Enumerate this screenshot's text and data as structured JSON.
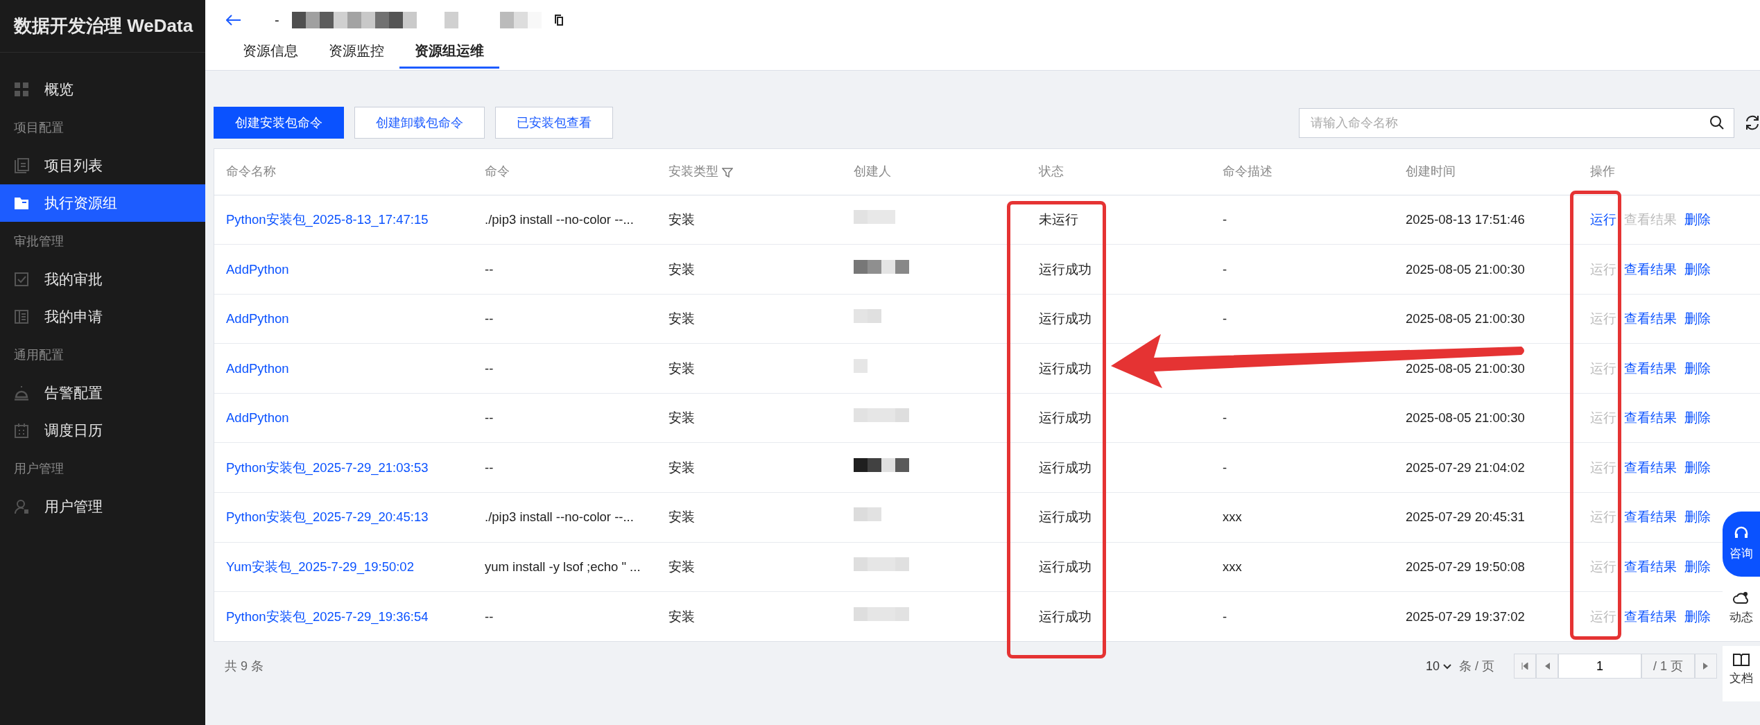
{
  "sidebar": {
    "brand": "数据开发治理 WeData",
    "items": [
      {
        "kind": "item",
        "label": "概览",
        "selected": false
      },
      {
        "kind": "section",
        "label": "项目配置"
      },
      {
        "kind": "item",
        "label": "项目列表",
        "selected": false
      },
      {
        "kind": "item",
        "label": "执行资源组",
        "selected": true
      },
      {
        "kind": "section",
        "label": "审批管理"
      },
      {
        "kind": "item",
        "label": "我的审批",
        "selected": false
      },
      {
        "kind": "item",
        "label": "我的申请",
        "selected": false
      },
      {
        "kind": "section",
        "label": "通用配置"
      },
      {
        "kind": "item",
        "label": "告警配置",
        "selected": false
      },
      {
        "kind": "item",
        "label": "调度日历",
        "selected": false
      },
      {
        "kind": "section",
        "label": "用户管理"
      },
      {
        "kind": "item",
        "label": "用户管理",
        "selected": false
      }
    ]
  },
  "header": {
    "title": "-",
    "tabs": [
      {
        "label": "资源信息",
        "selected": false
      },
      {
        "label": "资源监控",
        "selected": false
      },
      {
        "label": "资源组运维",
        "selected": true
      }
    ]
  },
  "toolbar": {
    "buttons": [
      {
        "label": "创建安装包命令",
        "kind": "primary"
      },
      {
        "label": "创建卸载包命令",
        "kind": "default"
      },
      {
        "label": "已安装包查看",
        "kind": "default"
      }
    ],
    "search": {
      "placeholder": "请输入命令名称"
    }
  },
  "table": {
    "columns": [
      {
        "label": "命令名称",
        "filter": false
      },
      {
        "label": "命令",
        "filter": false
      },
      {
        "label": "安装类型",
        "filter": true
      },
      {
        "label": "创建人",
        "filter": false
      },
      {
        "label": "状态",
        "filter": false
      },
      {
        "label": "命令描述",
        "filter": false
      },
      {
        "label": "创建时间",
        "filter": false
      },
      {
        "label": "操作",
        "filter": false
      }
    ],
    "rows": [
      {
        "name": "Python安装包_2025-8-13_17:47:15",
        "command": "./pip3 install --no-color --...",
        "type": "安装",
        "status": "未运行",
        "description": "-",
        "created": "2025-08-13 17:51:46",
        "actions": [
          {
            "label": "运行",
            "disabled": false
          },
          {
            "label": "查看结果",
            "disabled": true
          },
          {
            "label": "删除",
            "disabled": false
          }
        ]
      },
      {
        "name": "AddPython",
        "command": "--",
        "type": "安装",
        "status": "运行成功",
        "description": "-",
        "created": "2025-08-05 21:00:30",
        "actions": [
          {
            "label": "运行",
            "disabled": true
          },
          {
            "label": "查看结果",
            "disabled": false
          },
          {
            "label": "删除",
            "disabled": false
          }
        ]
      },
      {
        "name": "AddPython",
        "command": "--",
        "type": "安装",
        "status": "运行成功",
        "description": "-",
        "created": "2025-08-05 21:00:30",
        "actions": [
          {
            "label": "运行",
            "disabled": true
          },
          {
            "label": "查看结果",
            "disabled": false
          },
          {
            "label": "删除",
            "disabled": false
          }
        ]
      },
      {
        "name": "AddPython",
        "command": "--",
        "type": "安装",
        "status": "运行成功",
        "created": "2025-08-05 21:00:30",
        "actions": [
          {
            "label": "运行",
            "disabled": true
          },
          {
            "label": "查看结果",
            "disabled": false
          },
          {
            "label": "删除",
            "disabled": false
          }
        ]
      },
      {
        "name": "AddPython",
        "command": "--",
        "type": "安装",
        "status": "运行成功",
        "description": "-",
        "created": "2025-08-05 21:00:30",
        "actions": [
          {
            "label": "运行",
            "disabled": true
          },
          {
            "label": "查看结果",
            "disabled": false
          },
          {
            "label": "删除",
            "disabled": false
          }
        ]
      },
      {
        "name": "Python安装包_2025-7-29_21:03:53",
        "command": "--",
        "type": "安装",
        "status": "运行成功",
        "description": "-",
        "created": "2025-07-29 21:04:02",
        "actions": [
          {
            "label": "运行",
            "disabled": true
          },
          {
            "label": "查看结果",
            "disabled": false
          },
          {
            "label": "删除",
            "disabled": false
          }
        ]
      },
      {
        "name": "Python安装包_2025-7-29_20:45:13",
        "command": "./pip3 install --no-color --...",
        "type": "安装",
        "status": "运行成功",
        "description": "xxx",
        "created": "2025-07-29 20:45:31",
        "actions": [
          {
            "label": "运行",
            "disabled": true
          },
          {
            "label": "查看结果",
            "disabled": false
          },
          {
            "label": "删除",
            "disabled": false
          }
        ]
      },
      {
        "name": "Yum安装包_2025-7-29_19:50:02",
        "command": "yum install -y lsof ;echo \" ...",
        "type": "安装",
        "status": "运行成功",
        "description": "xxx",
        "created": "2025-07-29 19:50:08",
        "actions": [
          {
            "label": "运行",
            "disabled": true
          },
          {
            "label": "查看结果",
            "disabled": false
          },
          {
            "label": "删除",
            "disabled": false
          }
        ]
      },
      {
        "name": "Python安装包_2025-7-29_19:36:54",
        "command": "--",
        "type": "安装",
        "status": "运行成功",
        "description": "-",
        "created": "2025-07-29 19:37:02",
        "actions": [
          {
            "label": "运行",
            "disabled": true
          },
          {
            "label": "查看结果",
            "disabled": false
          },
          {
            "label": "删除",
            "disabled": false
          }
        ]
      }
    ]
  },
  "footer": {
    "total": "共 9 条",
    "page_size": "10",
    "per_page": "条 / 页",
    "page": "1",
    "pages": "/ 1 页"
  },
  "float_buttons": [
    {
      "label": "咨询",
      "kind": "primary"
    },
    {
      "label": "动态",
      "kind": "default"
    },
    {
      "label": "文档",
      "kind": "default"
    }
  ],
  "annotations": [
    {
      "kind": "box"
    },
    {
      "kind": "box"
    },
    {
      "kind": "arrow"
    }
  ]
}
